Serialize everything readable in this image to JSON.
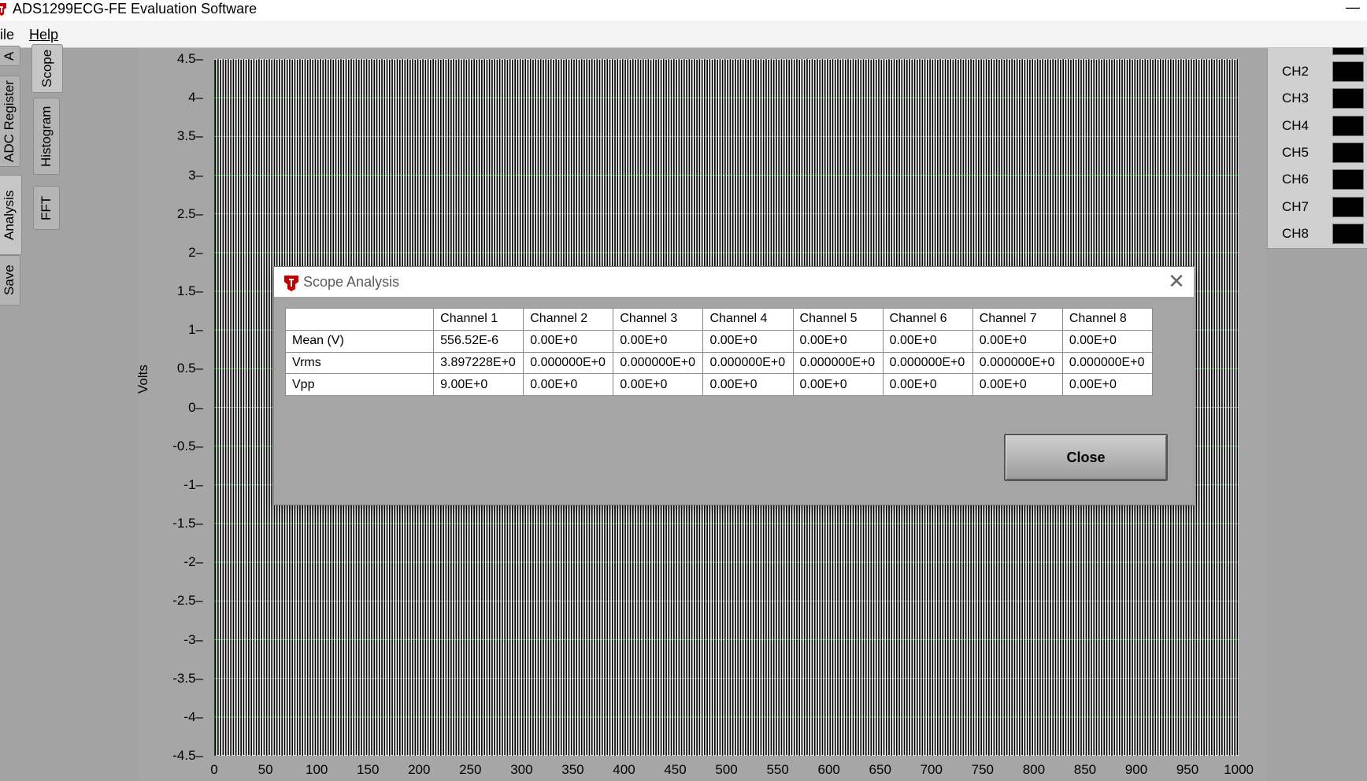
{
  "window": {
    "title": "ADS1299ECG-FE Evaluation Software",
    "minimize_glyph": "—"
  },
  "menu": {
    "file": "ile",
    "help": "Help"
  },
  "left_tabs": [
    {
      "label": "A"
    },
    {
      "label": "ADC Register"
    },
    {
      "label": "Analysis"
    },
    {
      "label": "Save"
    }
  ],
  "sub_tabs": [
    {
      "label": "Scope"
    },
    {
      "label": "Histogram"
    },
    {
      "label": "FFT"
    }
  ],
  "legend": {
    "channels": [
      "CH2",
      "CH3",
      "CH4",
      "CH5",
      "CH6",
      "CH7",
      "CH8"
    ],
    "swatch_color": "#000000"
  },
  "chart_data": {
    "type": "line",
    "ylabel": "Volts",
    "xlabel": "",
    "xlim": [
      0,
      1000
    ],
    "ylim": [
      -4.5,
      4.5
    ],
    "x_ticks": [
      "0",
      "50",
      "100",
      "150",
      "200",
      "250",
      "300",
      "350",
      "400",
      "450",
      "500",
      "550",
      "600",
      "650",
      "700",
      "750",
      "800",
      "850",
      "900",
      "950",
      "1000"
    ],
    "y_ticks": [
      "4.5",
      "4",
      "3.5",
      "3",
      "2.5",
      "2",
      "1.5",
      "1",
      "0.5",
      "0",
      "-0.5",
      "-1",
      "-1.5",
      "-2",
      "-2.5",
      "-3",
      "-3.5",
      "-4",
      "-4.5"
    ],
    "grid": true,
    "grid_color": "#2f8a2f",
    "background": "#000000",
    "series": [
      {
        "color": "#ffffff",
        "waveform": "square",
        "high": 4.5,
        "low": -4.5,
        "period_samples": 5
      }
    ]
  },
  "dialog": {
    "title": "Scope Analysis",
    "close_x": "✕",
    "table": {
      "columns": [
        "Channel 1",
        "Channel 2",
        "Channel 3",
        "Channel 4",
        "Channel 5",
        "Channel 6",
        "Channel 7",
        "Channel 8"
      ],
      "rows": [
        {
          "label": "Mean (V)",
          "values": [
            "556.52E-6",
            "0.00E+0",
            "0.00E+0",
            "0.00E+0",
            "0.00E+0",
            "0.00E+0",
            "0.00E+0",
            "0.00E+0"
          ]
        },
        {
          "label": "Vrms",
          "values": [
            "3.897228E+0",
            "0.000000E+0",
            "0.000000E+0",
            "0.000000E+0",
            "0.000000E+0",
            "0.000000E+0",
            "0.000000E+0",
            "0.000000E+0"
          ]
        },
        {
          "label": "Vpp",
          "values": [
            "9.00E+0",
            "0.00E+0",
            "0.00E+0",
            "0.00E+0",
            "0.00E+0",
            "0.00E+0",
            "0.00E+0",
            "0.00E+0"
          ]
        }
      ]
    },
    "close_button": "Close"
  }
}
